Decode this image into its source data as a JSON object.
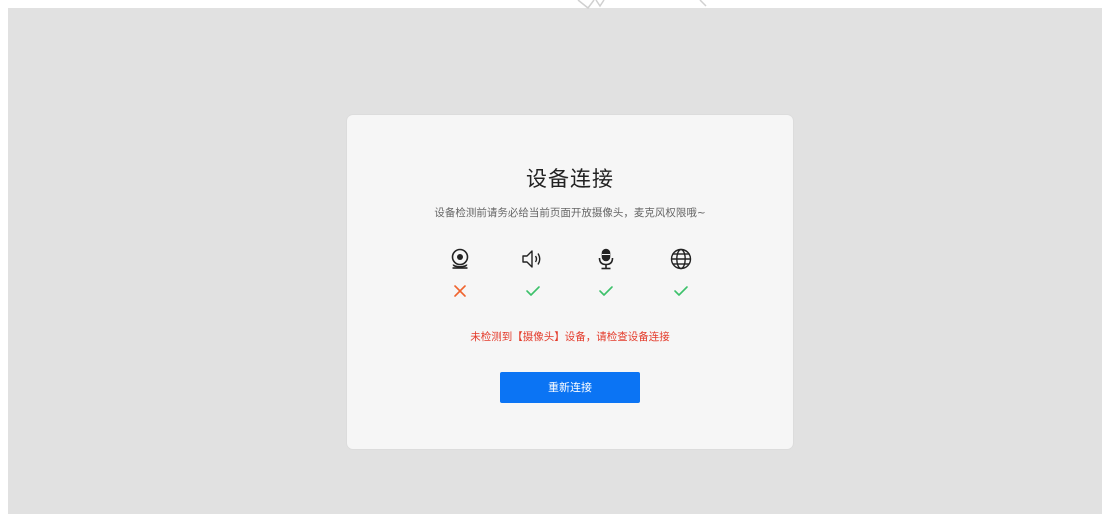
{
  "dialog": {
    "title": "设备连接",
    "subtitle": "设备检测前请务必给当前页面开放摄像头，麦克风权限哦~",
    "error_message": "未检测到【摄像头】设备，请检查设备连接",
    "button_label": "重新连接"
  },
  "devices": [
    {
      "icon": "camera-icon",
      "status": "fail",
      "status_icon": "cross-icon"
    },
    {
      "icon": "speaker-icon",
      "status": "ok",
      "status_icon": "check-icon"
    },
    {
      "icon": "microphone-icon",
      "status": "ok",
      "status_icon": "check-icon"
    },
    {
      "icon": "globe-icon",
      "status": "ok",
      "status_icon": "check-icon"
    }
  ],
  "colors": {
    "background": "#e1e1e1",
    "dialog": "#f6f6f6",
    "accent": "#0b74f4",
    "error": "#e43b2b",
    "success": "#3cc16a",
    "fail_icon": "#f0642e"
  }
}
